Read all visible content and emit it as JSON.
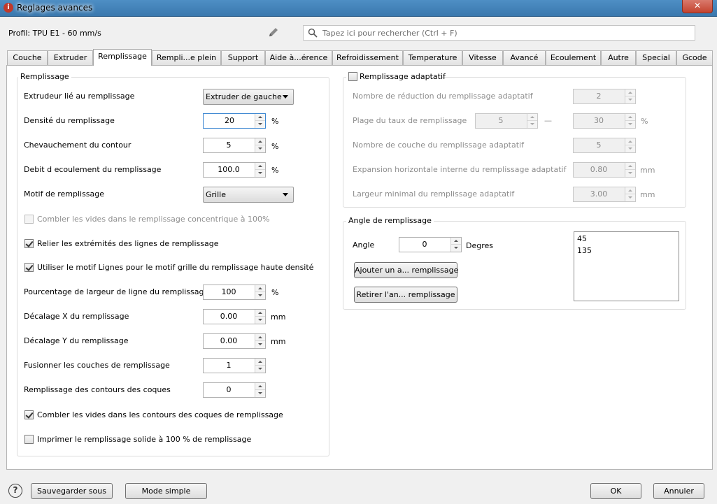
{
  "window": {
    "title": "Reglages avances",
    "close": "✕"
  },
  "profile": "Profil: TPU E1 - 60 mm/s",
  "search": {
    "placeholder": "Tapez ici pour rechercher (Ctrl + F)"
  },
  "tabs": [
    "Couche",
    "Extruder",
    "Remplissage",
    "Rempli...e plein",
    "Support",
    "Aide à...érence",
    "Refroidissement",
    "Temperature",
    "Vitesse",
    "Avancé",
    "Ecoulement",
    "Autre",
    "Special",
    "Gcode"
  ],
  "active_tab": "Remplissage",
  "infill": {
    "title": "Remplissage",
    "extruder_label": "Extrudeur lié au remplissage",
    "extruder_value": "Extruder de gauche",
    "density_label": "Densité du remplissage",
    "density_value": "20",
    "density_unit": "%",
    "overlap_label": "Chevauchement du contour",
    "overlap_value": "5",
    "overlap_unit": "%",
    "flow_label": "Debit d ecoulement du remplissage",
    "flow_value": "100.0",
    "flow_unit": "%",
    "pattern_label": "Motif de remplissage",
    "pattern_value": "Grille",
    "fill_gaps_concentric": "Combler les vides dans le remplissage concentrique à 100%",
    "connect_lines": "Relier les extrémités des lignes de remplissage",
    "use_lines": "Utiliser le motif Lignes pour le motif grille du remplissage haute densité",
    "width_pct_label": "Pourcentage de largeur de ligne du remplissage",
    "width_pct_value": "100",
    "width_pct_unit": "%",
    "offset_x_label": "Décalage X du remplissage",
    "offset_x_value": "0.00",
    "offset_x_unit": "mm",
    "offset_y_label": "Décalage Y du remplissage",
    "offset_y_value": "0.00",
    "offset_y_unit": "mm",
    "merge_label": "Fusionner les couches de remplissage",
    "merge_value": "1",
    "shell_label": "Remplissage des contours des coques",
    "shell_value": "0",
    "fill_gaps_shell": "Combler les vides dans les contours des coques de remplissage",
    "solid_print": "Imprimer le remplissage solide à 100 % de remplissage"
  },
  "adaptive": {
    "title": "Remplissage adaptatif",
    "reduction_label": "Nombre de réduction du remplissage adaptatif",
    "reduction_value": "2",
    "range_label": "Plage du taux de remplissage",
    "range_min": "5",
    "range_dash": "—",
    "range_max": "30",
    "range_unit": "%",
    "layers_label": "Nombre de couche du remplissage adaptatif",
    "layers_value": "5",
    "expansion_label": "Expansion horizontale interne du remplissage adaptatif",
    "expansion_value": "0.80",
    "expansion_unit": "mm",
    "minwidth_label": "Largeur minimal du remplissage adaptatif",
    "minwidth_value": "3.00",
    "minwidth_unit": "mm"
  },
  "angle": {
    "title": "Angle de remplissage",
    "label": "Angle",
    "value": "0",
    "unit": "Degres",
    "add_button": "Ajouter un a... remplissage",
    "remove_button": "Retirer l'an... remplissage",
    "list": [
      "45",
      "135"
    ]
  },
  "footer": {
    "help": "?",
    "save_as": "Sauvegarder sous",
    "simple_mode": "Mode simple",
    "ok": "OK",
    "cancel": "Annuler"
  }
}
